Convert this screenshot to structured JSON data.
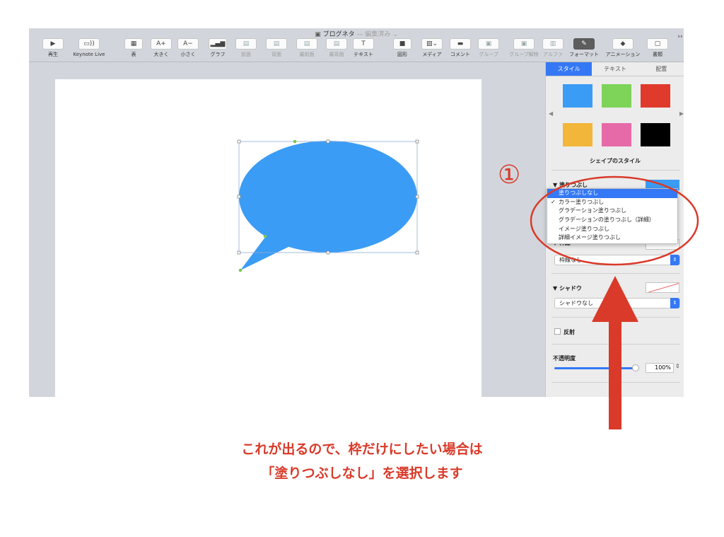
{
  "window": {
    "doc_title": "ブログネタ",
    "doc_status": "— 編集済み ⌄"
  },
  "toolbar": [
    {
      "name": "play",
      "icon": "▶",
      "label": "再生",
      "dim": false
    },
    {
      "name": "keynote-live",
      "icon": "▭))",
      "label": "Keynote Live",
      "dim": false
    },
    {
      "name": "table",
      "icon": "▦",
      "label": "表",
      "dim": false
    },
    {
      "name": "bigger",
      "icon": "A+",
      "label": "大きく",
      "dim": false
    },
    {
      "name": "smaller",
      "icon": "A−",
      "label": "小さく",
      "dim": false
    },
    {
      "name": "chart",
      "icon": "▂▄▆",
      "label": "グラフ",
      "dim": false
    },
    {
      "name": "forward",
      "icon": "▤",
      "label": "前面",
      "dim": true
    },
    {
      "name": "backward",
      "icon": "▤",
      "label": "背面",
      "dim": true
    },
    {
      "name": "front",
      "icon": "▤",
      "label": "最前面",
      "dim": true
    },
    {
      "name": "back",
      "icon": "▤",
      "label": "最背面",
      "dim": true
    },
    {
      "name": "text",
      "icon": "T",
      "label": "テキスト",
      "dim": false
    },
    {
      "name": "shape",
      "icon": "■",
      "label": "図形",
      "dim": false
    },
    {
      "name": "media",
      "icon": "▨⌄",
      "label": "メディア",
      "dim": false
    },
    {
      "name": "comment",
      "icon": "▬",
      "label": "コメント",
      "dim": false
    },
    {
      "name": "group",
      "icon": "▣",
      "label": "グループ",
      "dim": true
    },
    {
      "name": "ungroup",
      "icon": "▣",
      "label": "グループ解除",
      "dim": true
    },
    {
      "name": "alpha",
      "icon": "▥",
      "label": "アルファ",
      "dim": true
    },
    {
      "name": "format",
      "icon": "✎",
      "label": "フォーマット",
      "dim": false,
      "on": true
    },
    {
      "name": "animate",
      "icon": "◆",
      "label": "アニメーション",
      "dim": false
    },
    {
      "name": "document",
      "icon": "▢",
      "label": "書類",
      "dim": false
    }
  ],
  "toolbar_more": "››",
  "panel": {
    "tabs": [
      "スタイル",
      "テキスト",
      "配置"
    ],
    "swatch_colors": [
      "#3b9cf5",
      "#7dd458",
      "#df3a2b",
      "#f2b63a",
      "#e66aa7",
      "#000000"
    ],
    "style_title": "シェイプのスタイル",
    "fill_label": "塗りつぶし",
    "border_label": "枠線",
    "border_select": "枠線なし",
    "shadow_label": "シャドウ",
    "shadow_select": "シャドウなし",
    "reflection_label": "反射",
    "opacity_label": "不透明度",
    "opacity_value": "100%",
    "opacity_level": 1.0
  },
  "fill_menu": [
    {
      "label": "塗りつぶしなし",
      "highlighted": true,
      "checked": false
    },
    {
      "label": "カラー塗りつぶし",
      "highlighted": false,
      "checked": true
    },
    {
      "label": "グラデーション塗りつぶし",
      "highlighted": false,
      "checked": false
    },
    {
      "label": "グラデーションの塗りつぶし（詳細）",
      "highlighted": false,
      "checked": false
    },
    {
      "label": "イメージ塗りつぶし",
      "highlighted": false,
      "checked": false
    },
    {
      "label": "詳細イメージ塗りつぶし",
      "highlighted": false,
      "checked": false
    }
  ],
  "annotation": {
    "number": "①",
    "line1": "これが出るので、枠だけにしたい場合は",
    "line2": "「塗りつぶしなし」を選択します",
    "color": "#d93a2a"
  },
  "bubble_color": "#3b9cf5"
}
